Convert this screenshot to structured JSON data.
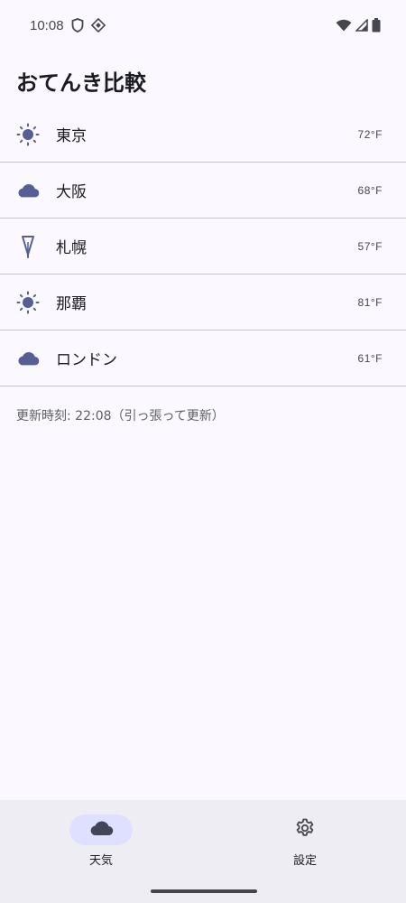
{
  "status_bar": {
    "time": "10:08",
    "icons": [
      "shield-icon",
      "sync-icon",
      "wifi-icon",
      "cell-signal-icon",
      "battery-icon"
    ]
  },
  "header": {
    "title": "おてんき比較"
  },
  "cities": [
    {
      "name": "東京",
      "temp": "72°F",
      "icon": "sun-icon"
    },
    {
      "name": "大阪",
      "temp": "68°F",
      "icon": "cloud-icon"
    },
    {
      "name": "札幌",
      "temp": "57°F",
      "icon": "umbrella-icon"
    },
    {
      "name": "那覇",
      "temp": "81°F",
      "icon": "sun-icon"
    },
    {
      "name": "ロンドン",
      "temp": "61°F",
      "icon": "cloud-icon"
    }
  ],
  "footer_note": "更新時刻: 22:08（引っ張って更新）",
  "bottom_nav": {
    "items": [
      {
        "label": "天気",
        "icon": "cloud-icon",
        "selected": true
      },
      {
        "label": "設定",
        "icon": "gear-icon",
        "selected": false
      }
    ]
  },
  "colors": {
    "background": "#fbf8ff",
    "icon_accent": "#565e96",
    "nav_background": "#efedf4",
    "nav_selected_pill": "#dfe0ff",
    "divider": "#c6c5d0"
  }
}
